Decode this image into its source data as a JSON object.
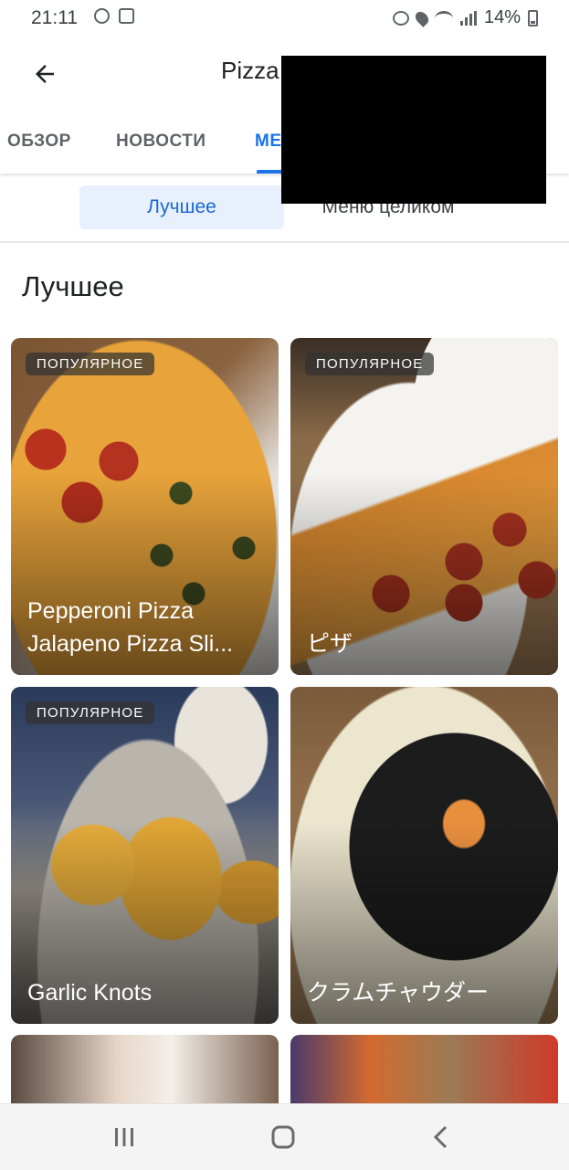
{
  "status_bar": {
    "time": "21:11",
    "battery": "14%"
  },
  "app_bar": {
    "title": "Pizza"
  },
  "tabs": [
    {
      "label": "ОБЗОР"
    },
    {
      "label": "НОВОСТИ"
    },
    {
      "label": "МЕ"
    }
  ],
  "subtabs": {
    "best": "Лучшее",
    "full_menu": "Меню целиком"
  },
  "section": {
    "heading": "Лучшее"
  },
  "cards": [
    {
      "badge": "ПОПУЛЯРНОЕ",
      "title_line1": "Pepperoni Pizza",
      "title_line2": "Jalapeno Pizza Sli..."
    },
    {
      "badge": "ПОПУЛЯРНОЕ",
      "title_line1": "ピザ"
    },
    {
      "badge": "ПОПУЛЯРНОЕ",
      "title_line1": "Garlic Knots"
    },
    {
      "title_line1": "クラムチャウダー"
    }
  ],
  "icons": {
    "back": "arrow-back-icon",
    "recents": "recents-icon",
    "home": "home-icon",
    "nav_back": "nav-back-icon"
  },
  "colors": {
    "accent": "#1a73e8",
    "chip_bg": "#e8f0fe"
  }
}
